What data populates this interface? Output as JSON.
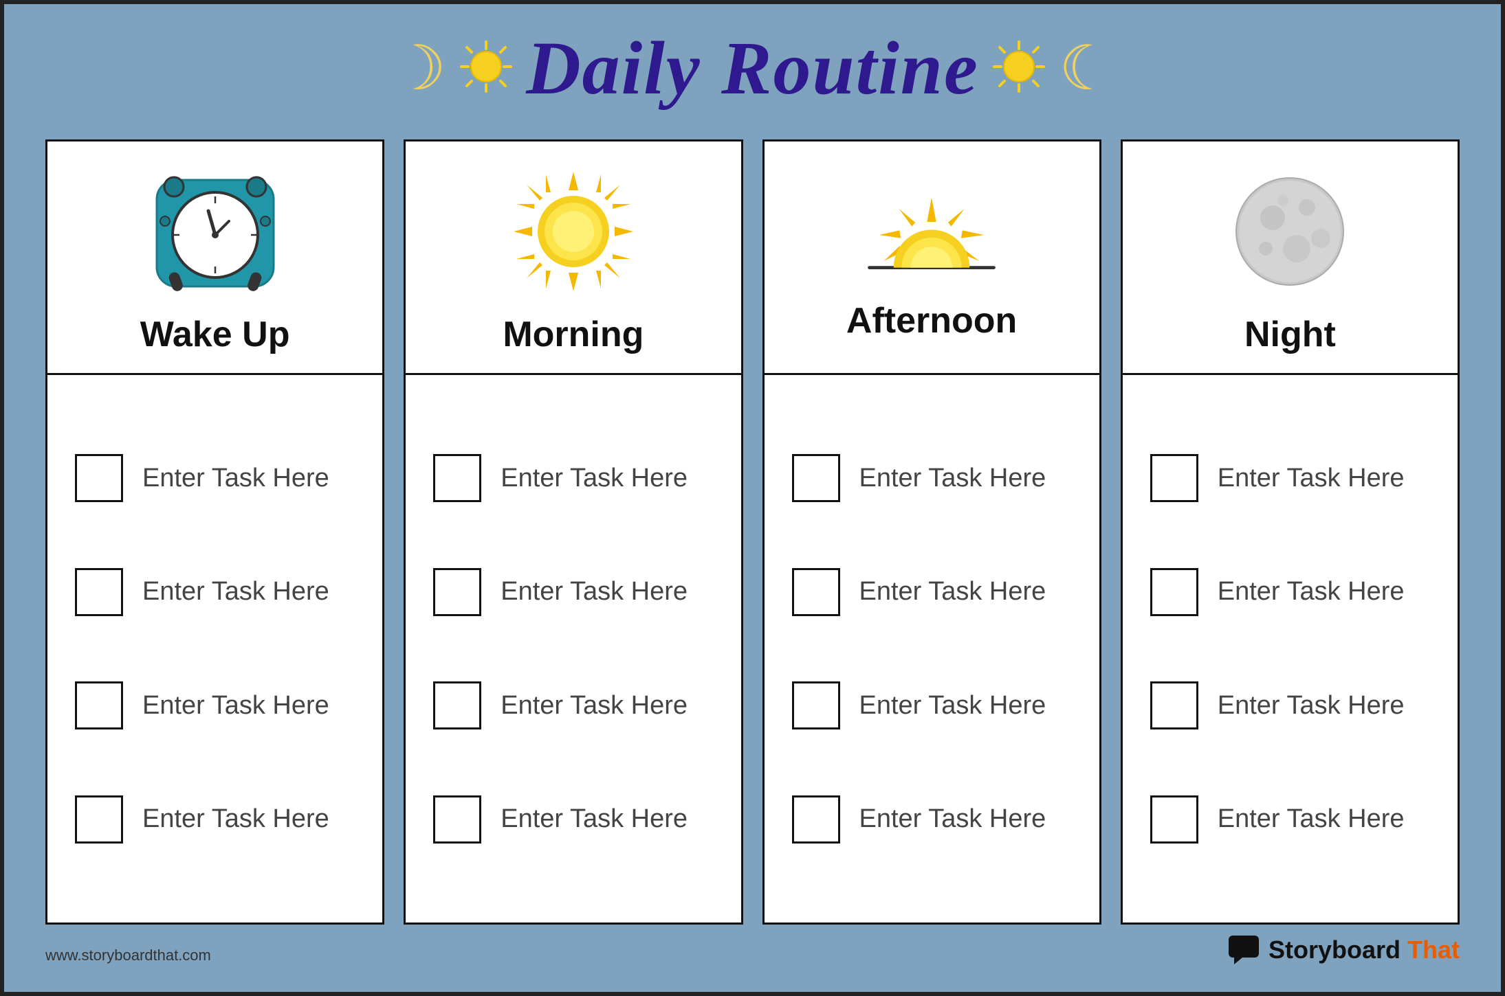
{
  "header": {
    "title": "Daily Routine",
    "moon_symbol": "☾",
    "sun_symbol": "✦"
  },
  "columns": [
    {
      "id": "wake-up",
      "label": "Wake Up",
      "icon": "clock",
      "tasks": [
        "Enter Task Here",
        "Enter Task Here",
        "Enter Task Here",
        "Enter Task Here"
      ]
    },
    {
      "id": "morning",
      "label": "Morning",
      "icon": "sun",
      "tasks": [
        "Enter Task Here",
        "Enter Task Here",
        "Enter Task Here",
        "Enter Task Here"
      ]
    },
    {
      "id": "afternoon",
      "label": "Afternoon",
      "icon": "afternoon-sun",
      "tasks": [
        "Enter Task Here",
        "Enter Task Here",
        "Enter Task Here",
        "Enter Task Here"
      ]
    },
    {
      "id": "night",
      "label": "Night",
      "icon": "moon",
      "tasks": [
        "Enter Task Here",
        "Enter Task Here",
        "Enter Task Here",
        "Enter Task Here"
      ]
    }
  ],
  "footer": {
    "url": "www.storyboardthat.com",
    "brand_storyboard": "Storyboard",
    "brand_that": "That"
  },
  "colors": {
    "background": "#7fa3be",
    "title": "#2e1a8e",
    "accent_yellow": "#f5d020",
    "accent_orange": "#e85d04"
  }
}
